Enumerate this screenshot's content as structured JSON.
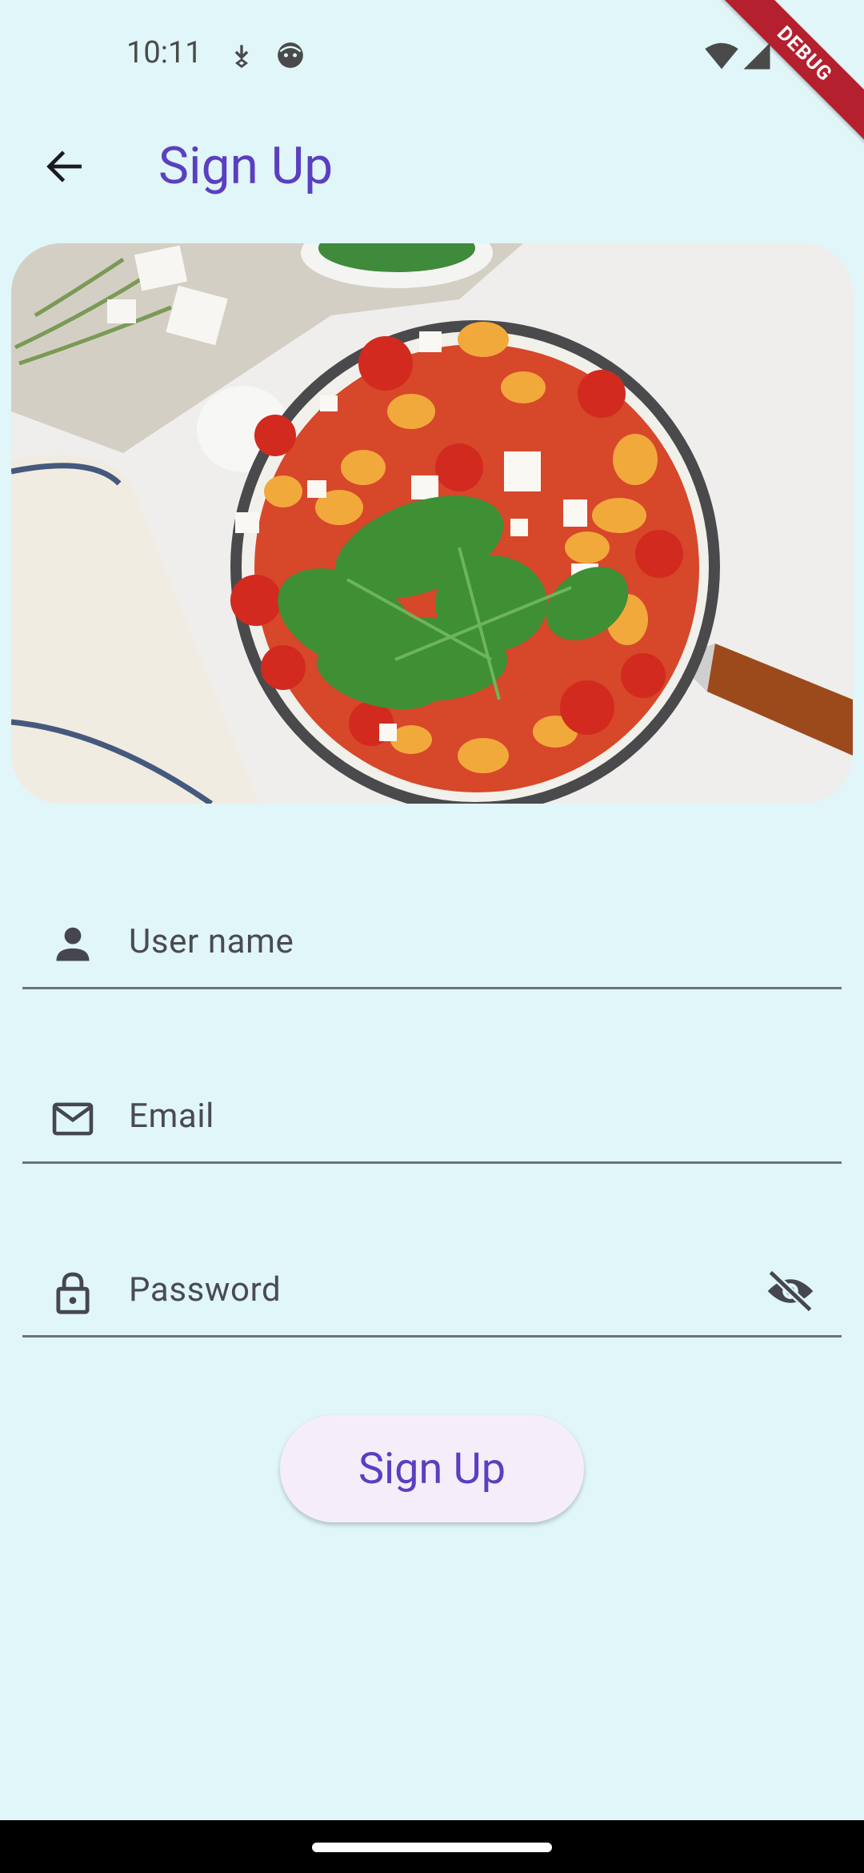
{
  "status_bar": {
    "time": "10:11",
    "left_icons": [
      "download-icon",
      "face-icon"
    ],
    "right_icons": [
      "wifi-icon",
      "signal-icon"
    ]
  },
  "debug_banner": "DEBUG",
  "app_bar": {
    "back_icon": "arrow-back-icon",
    "title": "Sign Up"
  },
  "hero_image": {
    "subject": "skillet of gnocchi with tomatoes, feta and spinach"
  },
  "form": {
    "username": {
      "label": "User name",
      "icon": "person-icon",
      "value": ""
    },
    "email": {
      "label": "Email",
      "icon": "mail-icon",
      "value": ""
    },
    "password": {
      "label": "Password",
      "icon": "lock-icon",
      "toggle_icon": "visibility-off-icon",
      "value": ""
    }
  },
  "submit_button": {
    "label": "Sign Up"
  },
  "colors": {
    "background": "#e0f6f8",
    "accent": "#5b3fc0",
    "button_fill": "#f5eefa",
    "underline": "#6f7277",
    "debug": "#b5202e"
  }
}
